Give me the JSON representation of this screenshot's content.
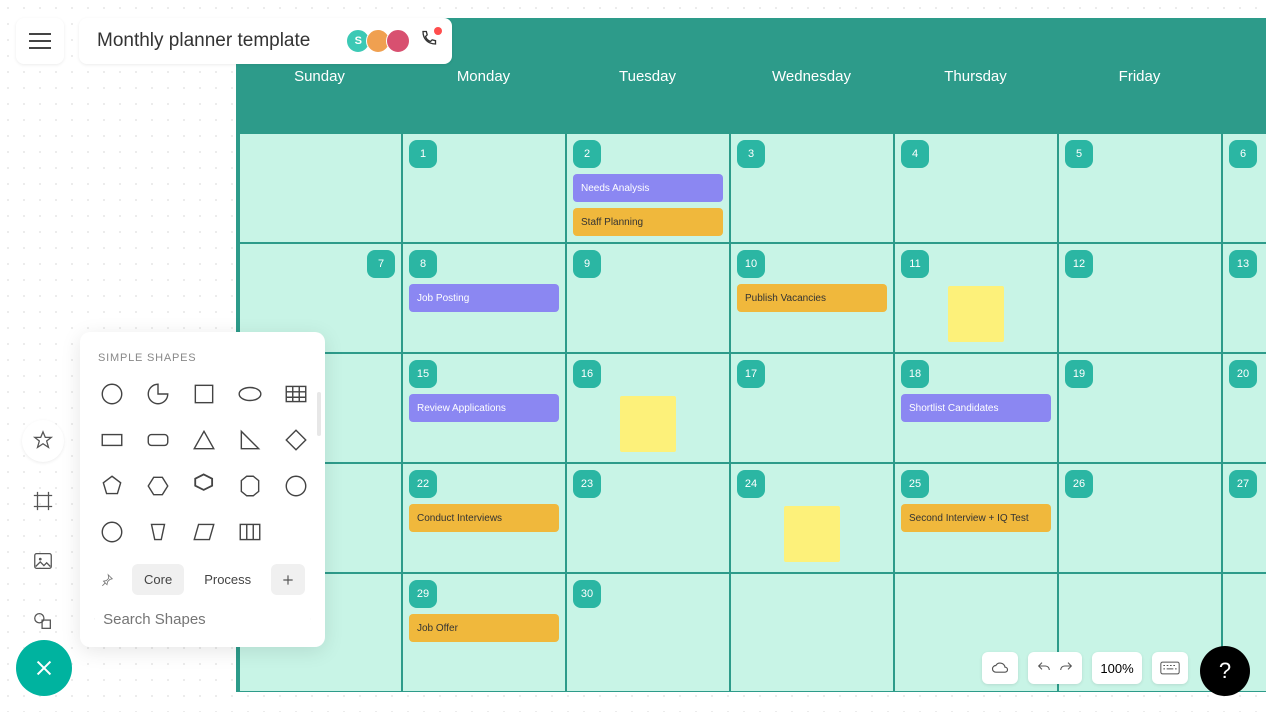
{
  "header": {
    "title": "Monthly planner template",
    "avatars": [
      {
        "initial": "S",
        "color": "#3cc9b5"
      },
      {
        "initial": "",
        "color": "#f0a050"
      },
      {
        "initial": "",
        "color": "#d85070"
      }
    ]
  },
  "shapes_panel": {
    "heading": "SIMPLE SHAPES",
    "tabs": {
      "pin": "📌",
      "core": "Core",
      "process": "Process",
      "add": "+"
    },
    "search_placeholder": "Search Shapes"
  },
  "calendar": {
    "headers": [
      "Sunday",
      "Monday",
      "Tuesday",
      "Wednesday",
      "Thursday",
      "Friday",
      ""
    ],
    "weeks": [
      [
        {
          "day": "",
          "sun": true
        },
        {
          "day": "1"
        },
        {
          "day": "2",
          "events": [
            {
              "t": "Needs Analysis",
              "c": "purple"
            },
            {
              "t": "Staff Planning",
              "c": "orange"
            }
          ]
        },
        {
          "day": "3"
        },
        {
          "day": "4"
        },
        {
          "day": "5"
        },
        {
          "day": "6"
        }
      ],
      [
        {
          "day": "7",
          "sun": true
        },
        {
          "day": "8",
          "events": [
            {
              "t": "Job Posting",
              "c": "purple"
            }
          ]
        },
        {
          "day": "9"
        },
        {
          "day": "10",
          "events": [
            {
              "t": "Publish Vacancies",
              "c": "orange"
            }
          ]
        },
        {
          "day": "11",
          "sticky": true
        },
        {
          "day": "12"
        },
        {
          "day": "13"
        }
      ],
      [
        {
          "day": "",
          "sun": true
        },
        {
          "day": "15",
          "events": [
            {
              "t": "Review Applications",
              "c": "purple"
            }
          ]
        },
        {
          "day": "16",
          "sticky": true
        },
        {
          "day": "17"
        },
        {
          "day": "18",
          "events": [
            {
              "t": "Shortlist Candidates",
              "c": "purple"
            }
          ]
        },
        {
          "day": "19"
        },
        {
          "day": "20"
        }
      ],
      [
        {
          "day": "",
          "sun": true
        },
        {
          "day": "22",
          "events": [
            {
              "t": "Conduct Interviews",
              "c": "orange"
            }
          ]
        },
        {
          "day": "23"
        },
        {
          "day": "24",
          "sticky": true
        },
        {
          "day": "25",
          "events": [
            {
              "t": "Second Interview + IQ Test",
              "c": "orange"
            }
          ]
        },
        {
          "day": "26"
        },
        {
          "day": "27"
        }
      ],
      [
        {
          "day": "",
          "sun": true
        },
        {
          "day": "29",
          "events": [
            {
              "t": "Job Offer",
              "c": "orange"
            }
          ]
        },
        {
          "day": "30"
        },
        {
          "day": ""
        },
        {
          "day": ""
        },
        {
          "day": ""
        },
        {
          "day": ""
        }
      ]
    ]
  },
  "bottombar": {
    "zoom": "100%"
  }
}
